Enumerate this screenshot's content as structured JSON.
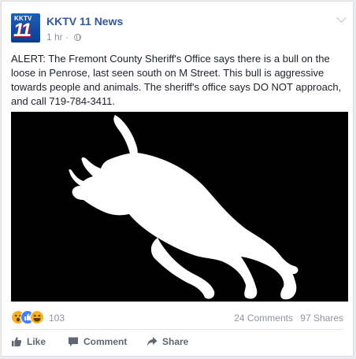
{
  "post": {
    "page_name": "KKTV 11 News",
    "logo": {
      "top_text": "KKTV",
      "number": "11"
    },
    "timestamp": "1 hr",
    "privacy_separator": "·",
    "text": "ALERT: The Fremont County Sheriff's Office says there is a bull on the loose in Penrose, last seen south on M Street. This bull is aggressive towards people and animals. The sheriff's office says DO NOT approach, and call 719-784-3411."
  },
  "engagement": {
    "reaction_icons": [
      "wow-icon",
      "like-icon",
      "haha-icon"
    ],
    "reaction_count": "103",
    "comments": "24 Comments",
    "shares": "97 Shares"
  },
  "actions": {
    "like": "Like",
    "comment": "Comment",
    "share": "Share"
  },
  "colors": {
    "page_name": "#365899",
    "meta": "#90949c",
    "image_bg": "#000000",
    "like_blue": "#4080ff",
    "reaction_yellow": "#f7b125"
  }
}
